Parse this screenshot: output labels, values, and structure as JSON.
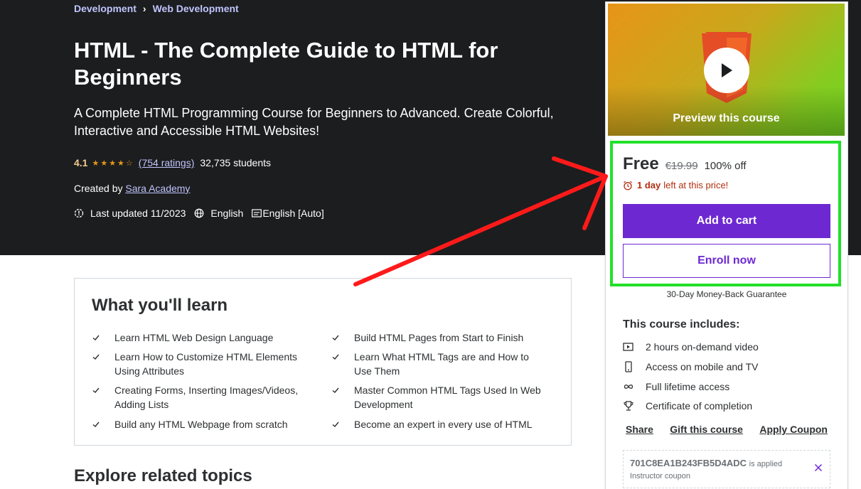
{
  "breadcrumb": {
    "items": [
      "Development",
      "Web Development"
    ],
    "separator": "›"
  },
  "course": {
    "title": "HTML - The Complete Guide to HTML for Beginners",
    "subtitle": "A Complete HTML Programming Course for Beginners to Advanced. Create Colorful, Interactive and Accessible HTML Websites!",
    "rating": "4.1",
    "stars": "★★★★☆",
    "ratings_count": "(754 ratings)",
    "students": "32,735 students",
    "created_by_label": "Created by",
    "author": "Sara Academy",
    "last_updated": "Last updated 11/2023",
    "language": "English",
    "captions": "English [Auto]"
  },
  "learn": {
    "title": "What you'll learn",
    "items": [
      "Learn HTML Web Design Language",
      "Build HTML Pages from Start to Finish",
      "Learn How to Customize HTML Elements Using Attributes",
      "Learn What HTML Tags are and How to Use Them",
      "Creating Forms, Inserting Images/Videos, Adding Lists",
      "Master Common HTML Tags Used In Web Development",
      "Build any HTML Webpage from scratch",
      "Become an expert in every use of HTML"
    ]
  },
  "explore": {
    "title": "Explore related topics"
  },
  "sidebar": {
    "preview_label": "Preview this course",
    "price": "Free",
    "original_price": "€19.99",
    "discount": "100% off",
    "timer_bold": "1 day",
    "timer_rest": "left at this price!",
    "add_to_cart": "Add to cart",
    "enroll_now": "Enroll now",
    "guarantee": "30-Day Money-Back Guarantee",
    "includes_title": "This course includes:",
    "includes": [
      {
        "icon": "video-icon",
        "label": "2 hours on-demand video"
      },
      {
        "icon": "mobile-icon",
        "label": "Access on mobile and TV"
      },
      {
        "icon": "infinity-icon",
        "label": "Full lifetime access"
      },
      {
        "icon": "trophy-icon",
        "label": "Certificate of completion"
      }
    ],
    "links": [
      "Share",
      "Gift this course",
      "Apply Coupon"
    ],
    "coupon": {
      "code": "701C8EA1B243FB5D4ADC",
      "applied": "is applied",
      "type": "Instructor coupon"
    }
  },
  "colors": {
    "hero_bg": "#1c1d1f",
    "accent_purple": "#6d28d2",
    "link_purple": "#c0c4fc",
    "rating_gold": "#e59819",
    "timer_red": "#b32d0f",
    "highlight_green": "#22e02a",
    "annotation_red": "#ff1a1a"
  }
}
